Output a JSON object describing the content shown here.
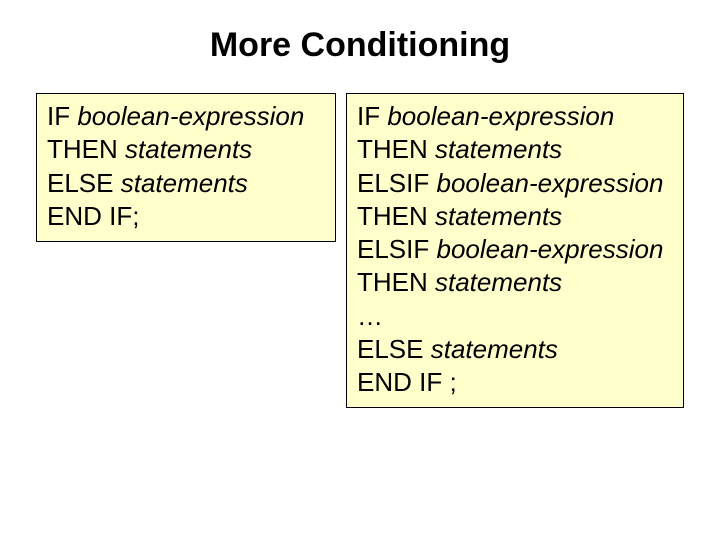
{
  "title": "More Conditioning",
  "left": {
    "l1a": "IF ",
    "l1b": "boolean-expression",
    "l2a": "THEN ",
    "l2b": "statements",
    "l3a": "ELSE ",
    "l3b": "statements",
    "l4": "END IF;"
  },
  "right": {
    "l1a": "IF ",
    "l1b": "boolean-expression",
    "l2a": " THEN ",
    "l2b": "statements",
    "l3a": " ELSIF ",
    "l3b": "boolean-expression",
    "l4a": " THEN ",
    "l4b": "statements",
    "l5a": " ELSIF ",
    "l5b": "boolean-expression",
    "l6a": " THEN ",
    "l6b": "statements",
    "l7": "…",
    "l8a": " ELSE ",
    "l8b": "statements",
    "l9": " END IF ;"
  }
}
